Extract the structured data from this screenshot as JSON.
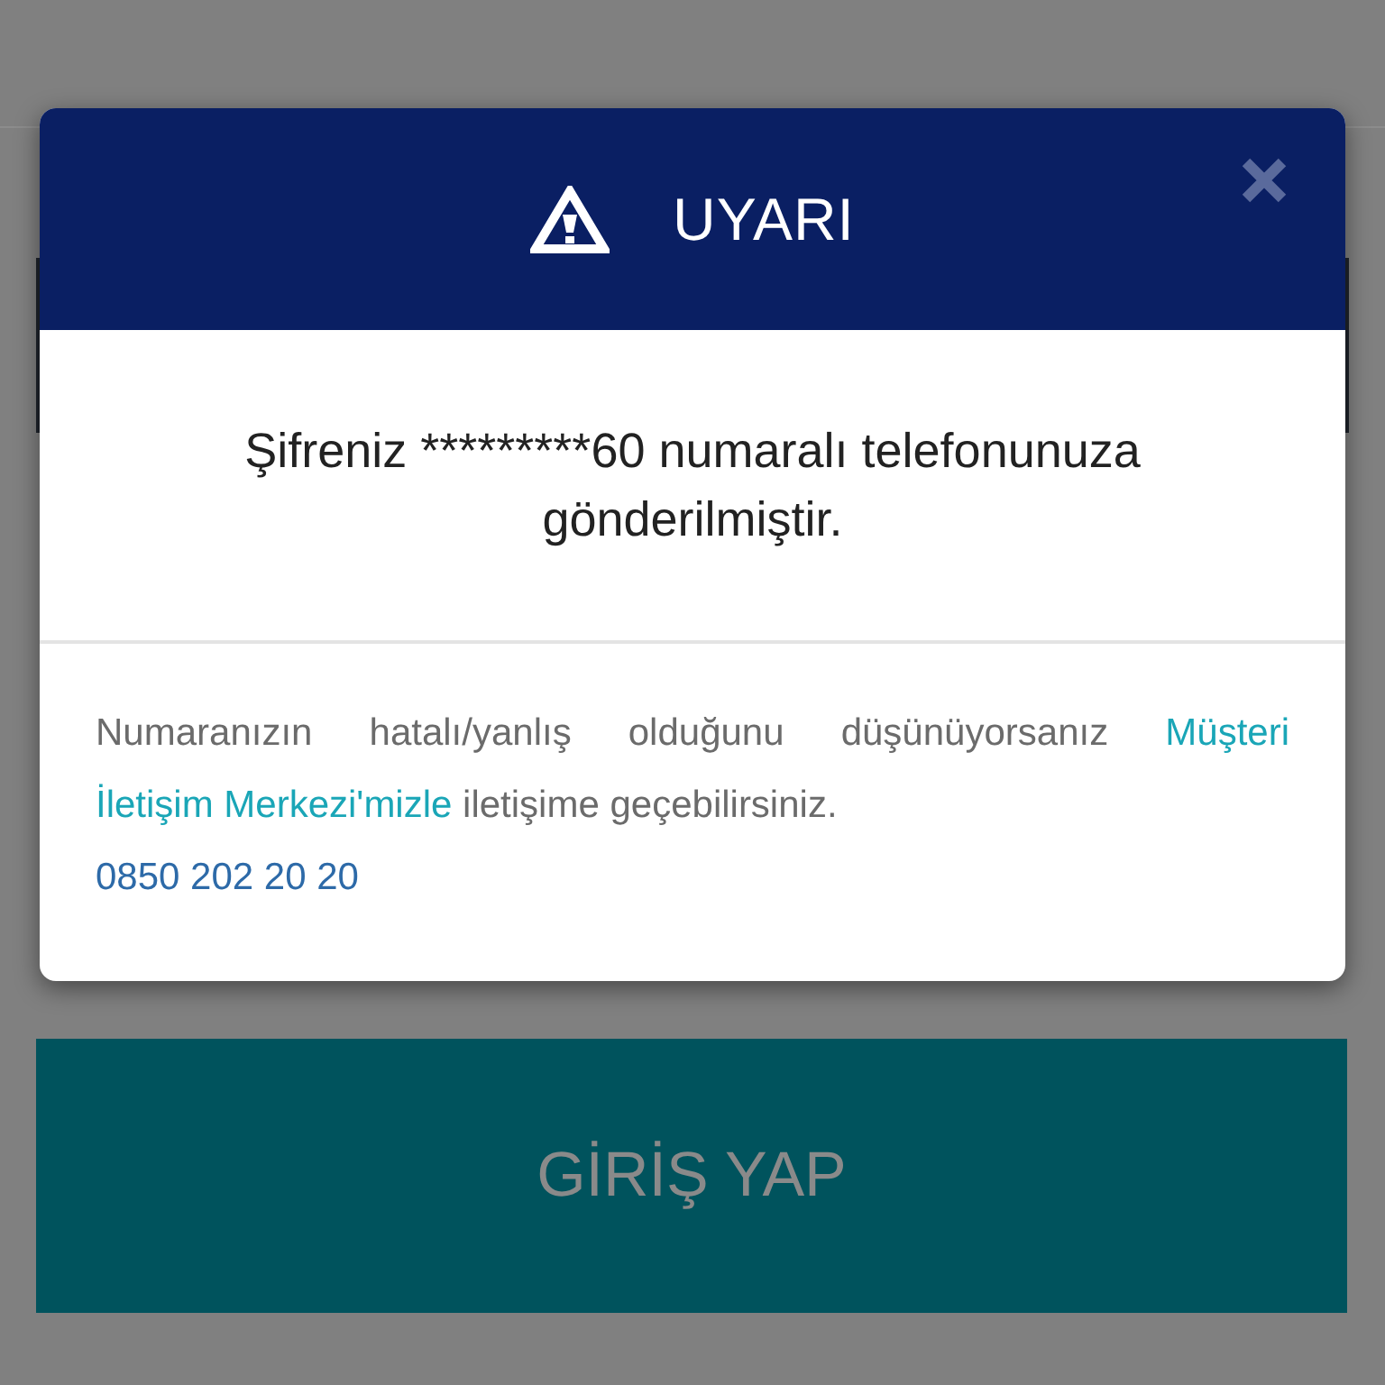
{
  "modal": {
    "title": "UYARI",
    "message": "Şifreniz *********60 numaralı telefonunuza gönderilmiştir.",
    "info": [
      {
        "kind": "text",
        "text": "Numaranızın hatalı/yanlış olduğunu düşünüyorsanız"
      },
      {
        "kind": "link",
        "text": "Müşteri"
      },
      {
        "kind": "link",
        "text": "İletişim Merkezi'mizle"
      },
      {
        "kind": "text",
        "text": "iletişime geçebilirsiniz."
      }
    ],
    "phone": "0850 202 20 20"
  },
  "page": {
    "login_button": "GİRİŞ YAP"
  }
}
